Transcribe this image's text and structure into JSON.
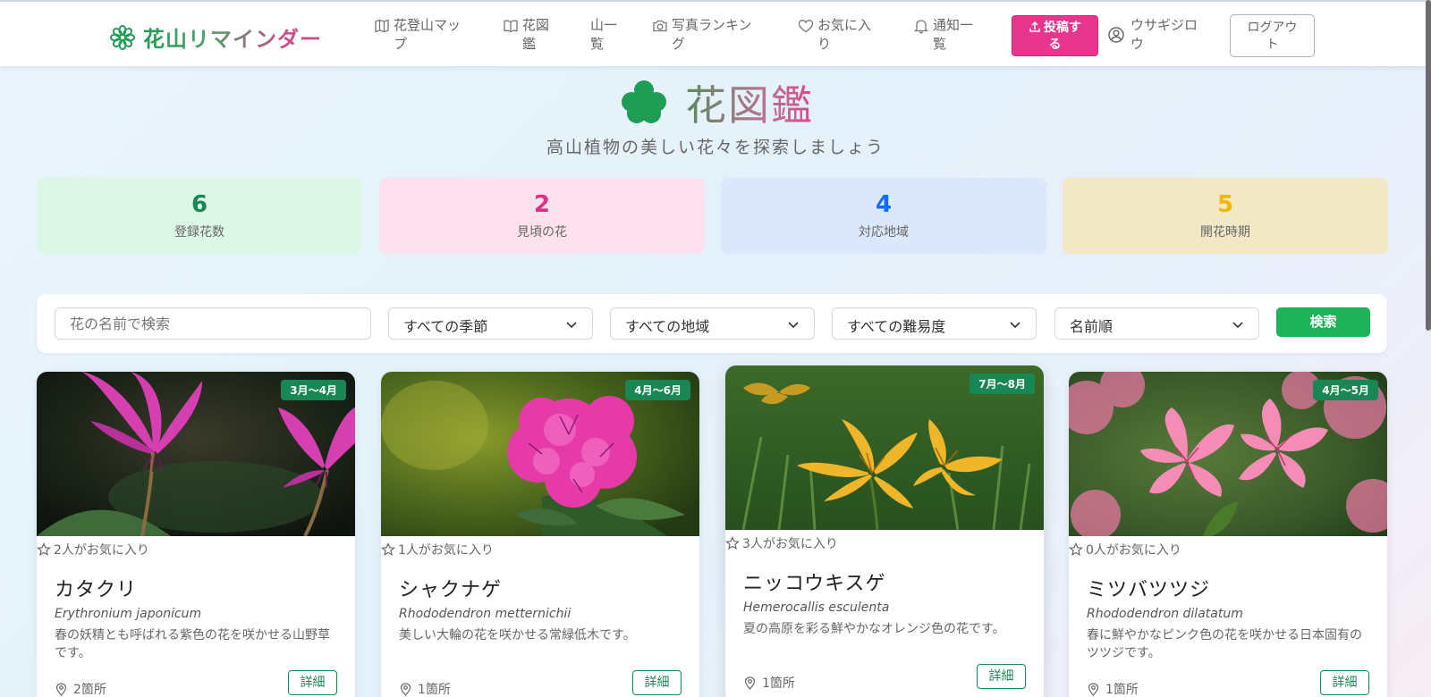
{
  "header": {
    "brand": "花山リマインダー",
    "nav": [
      {
        "label": "花登山マッ\nプ",
        "icon": "map-icon"
      },
      {
        "label": "花図\n鑑",
        "icon": "book-icon"
      },
      {
        "label": "山一\n覧",
        "icon": "none"
      },
      {
        "label": "写真ランキン\nグ",
        "icon": "camera-icon"
      },
      {
        "label": "お気に入\nり",
        "icon": "heart-icon"
      },
      {
        "label": "通知一\n覧",
        "icon": "bell-icon"
      }
    ],
    "post_button": "投稿す\nる",
    "user_name": "ウサギジロ\nウ",
    "logout_button": "ログアウ\nト"
  },
  "hero": {
    "title": "花図鑑",
    "subtitle": "高山植物の美しい花々を探索しましょう"
  },
  "stats": [
    {
      "value": "6",
      "label": "登録花数",
      "bg": "#dcf7e6",
      "color": "#198754"
    },
    {
      "value": "2",
      "label": "見頃の花",
      "bg": "#fde2ee",
      "color": "#d63384"
    },
    {
      "value": "4",
      "label": "対応地域",
      "bg": "#dbe8fb",
      "color": "#0d6efd"
    },
    {
      "value": "5",
      "label": "開花時期",
      "bg": "#f3e8c5",
      "color": "#f0b800"
    }
  ],
  "search": {
    "placeholder": "花の名前で検索",
    "season": "すべての季節",
    "region": "すべての地域",
    "difficulty": "すべての難易度",
    "sort": "名前順",
    "button": "検索"
  },
  "cards": [
    {
      "season": "3月〜4月",
      "favorites": "2人がお気に入り",
      "name": "カタクリ",
      "scientific": "Erythronium japonicum",
      "description": "春の妖精とも呼ばれる紫色の花を咲かせる山野草です。",
      "locations": "2箇所",
      "detail": "詳細"
    },
    {
      "season": "4月〜6月",
      "favorites": "1人がお気に入り",
      "name": "シャクナゲ",
      "scientific": "Rhododendron metternichii",
      "description": "美しい大輪の花を咲かせる常緑低木です。",
      "locations": "1箇所",
      "detail": "詳細"
    },
    {
      "season": "7月〜8月",
      "favorites": "3人がお気に入り",
      "name": "ニッコウキスゲ",
      "scientific": "Hemerocallis esculenta",
      "description": "夏の高原を彩る鮮やかなオレンジ色の花です。",
      "locations": "1箇所",
      "detail": "詳細"
    },
    {
      "season": "4月〜5月",
      "favorites": "0人がお気に入り",
      "name": "ミツバツツジ",
      "scientific": "Rhododendron dilatatum",
      "description": "春に鮮やかなピンク色の花を咲かせる日本固有のツツジです。",
      "locations": "1箇所",
      "detail": "詳細"
    }
  ]
}
